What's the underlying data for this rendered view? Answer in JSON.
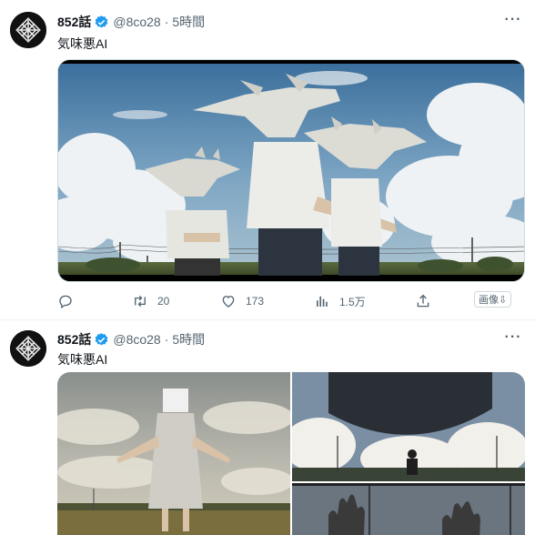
{
  "tweets": [
    {
      "author": {
        "name": "852話",
        "handle": "@8co28",
        "time": "5時間"
      },
      "dot": "·",
      "text": "気味悪AI",
      "more": "···",
      "actions": {
        "replies": "",
        "retweets": "20",
        "likes": "173",
        "views": "1.5万",
        "image_button": "画像⇩"
      }
    },
    {
      "author": {
        "name": "852話",
        "handle": "@8co28",
        "time": "5時間"
      },
      "dot": "·",
      "text": "気味悪AI",
      "more": "···"
    }
  ],
  "icons": {
    "verified": "verified-badge-icon",
    "reply": "reply-icon",
    "retweet": "retweet-icon",
    "like": "heart-icon",
    "views": "views-icon",
    "share": "share-icon",
    "more": "more-icon"
  },
  "colors": {
    "verified": "#1d9bf0",
    "text_primary": "#0f1419",
    "text_secondary": "#536471",
    "border": "#cfd9de"
  }
}
